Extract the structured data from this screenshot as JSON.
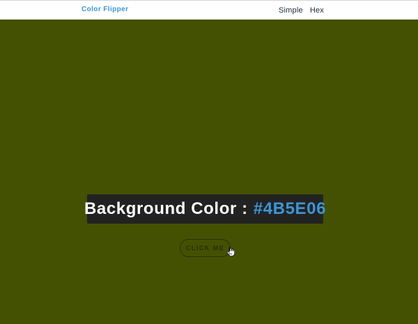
{
  "navbar": {
    "brand": "Color Flipper",
    "links": [
      "Simple",
      "Hex"
    ]
  },
  "main": {
    "label": "Background Color :",
    "color_value": "#4B5E06",
    "button_label": "CLICK ME"
  },
  "colors": {
    "accent": "#3D95D6",
    "panel": "#222222",
    "page_background": "#445103"
  },
  "icons": {
    "cursor": "hand-pointer-icon"
  }
}
